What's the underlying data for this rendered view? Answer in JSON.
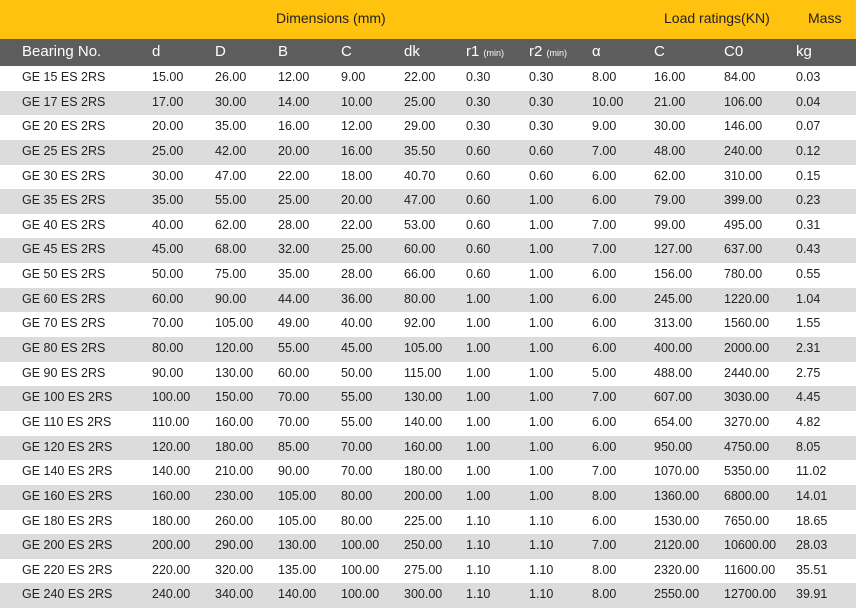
{
  "header": {
    "dimensions_label": "Dimensions (mm)",
    "load_label": "Load ratings(KN)",
    "mass_label": "Mass"
  },
  "columns": [
    "Bearing No.",
    "d",
    "D",
    "B",
    "C",
    "dk",
    "r1",
    "r2",
    "α",
    "C",
    "C0",
    "kg"
  ],
  "column_notes": {
    "r1": "(min)",
    "r2": "(min)"
  },
  "rows": [
    [
      "GE 15 ES  2RS",
      "15.00",
      "26.00",
      "12.00",
      "9.00",
      "22.00",
      "0.30",
      "0.30",
      "8.00",
      "16.00",
      "84.00",
      "0.03"
    ],
    [
      "GE 17 ES  2RS",
      "17.00",
      "30.00",
      "14.00",
      "10.00",
      "25.00",
      "0.30",
      "0.30",
      "10.00",
      "21.00",
      "106.00",
      "0.04"
    ],
    [
      "GE 20 ES  2RS",
      "20.00",
      "35.00",
      "16.00",
      "12.00",
      "29.00",
      "0.30",
      "0.30",
      "9.00",
      "30.00",
      "146.00",
      "0.07"
    ],
    [
      "GE 25 ES  2RS",
      "25.00",
      "42.00",
      "20.00",
      "16.00",
      "35.50",
      "0.60",
      "0.60",
      "7.00",
      "48.00",
      "240.00",
      "0.12"
    ],
    [
      "GE 30 ES  2RS",
      "30.00",
      "47.00",
      "22.00",
      "18.00",
      "40.70",
      "0.60",
      "0.60",
      "6.00",
      "62.00",
      "310.00",
      "0.15"
    ],
    [
      "GE 35 ES  2RS",
      "35.00",
      "55.00",
      "25.00",
      "20.00",
      "47.00",
      "0.60",
      "1.00",
      "6.00",
      "79.00",
      "399.00",
      "0.23"
    ],
    [
      "GE 40 ES  2RS",
      "40.00",
      "62.00",
      "28.00",
      "22.00",
      "53.00",
      "0.60",
      "1.00",
      "7.00",
      "99.00",
      "495.00",
      "0.31"
    ],
    [
      "GE 45 ES  2RS",
      "45.00",
      "68.00",
      "32.00",
      "25.00",
      "60.00",
      "0.60",
      "1.00",
      "7.00",
      "127.00",
      "637.00",
      "0.43"
    ],
    [
      "GE 50 ES  2RS",
      "50.00",
      "75.00",
      "35.00",
      "28.00",
      "66.00",
      "0.60",
      "1.00",
      "6.00",
      "156.00",
      "780.00",
      "0.55"
    ],
    [
      "GE 60 ES  2RS",
      "60.00",
      "90.00",
      "44.00",
      "36.00",
      "80.00",
      "1.00",
      "1.00",
      "6.00",
      "245.00",
      "1220.00",
      "1.04"
    ],
    [
      "GE 70 ES  2RS",
      "70.00",
      "105.00",
      "49.00",
      "40.00",
      "92.00",
      "1.00",
      "1.00",
      "6.00",
      "313.00",
      "1560.00",
      "1.55"
    ],
    [
      "GE 80 ES  2RS",
      "80.00",
      "120.00",
      "55.00",
      "45.00",
      "105.00",
      "1.00",
      "1.00",
      "6.00",
      "400.00",
      "2000.00",
      "2.31"
    ],
    [
      "GE 90 ES  2RS",
      "90.00",
      "130.00",
      "60.00",
      "50.00",
      "115.00",
      "1.00",
      "1.00",
      "5.00",
      "488.00",
      "2440.00",
      "2.75"
    ],
    [
      "GE 100 ES  2RS",
      "100.00",
      "150.00",
      "70.00",
      "55.00",
      "130.00",
      "1.00",
      "1.00",
      "7.00",
      "607.00",
      "3030.00",
      "4.45"
    ],
    [
      "GE 110 ES  2RS",
      "110.00",
      "160.00",
      "70.00",
      "55.00",
      "140.00",
      "1.00",
      "1.00",
      "6.00",
      "654.00",
      "3270.00",
      "4.82"
    ],
    [
      "GE 120 ES  2RS",
      "120.00",
      "180.00",
      "85.00",
      "70.00",
      "160.00",
      "1.00",
      "1.00",
      "6.00",
      "950.00",
      "4750.00",
      "8.05"
    ],
    [
      "GE 140 ES  2RS",
      "140.00",
      "210.00",
      "90.00",
      "70.00",
      "180.00",
      "1.00",
      "1.00",
      "7.00",
      "1070.00",
      "5350.00",
      "11.02"
    ],
    [
      "GE 160 ES  2RS",
      "160.00",
      "230.00",
      "105.00",
      "80.00",
      "200.00",
      "1.00",
      "1.00",
      "8.00",
      "1360.00",
      "6800.00",
      "14.01"
    ],
    [
      "GE 180 ES  2RS",
      "180.00",
      "260.00",
      "105.00",
      "80.00",
      "225.00",
      "1.10",
      "1.10",
      "6.00",
      "1530.00",
      "7650.00",
      "18.65"
    ],
    [
      "GE 200 ES  2RS",
      "200.00",
      "290.00",
      "130.00",
      "100.00",
      "250.00",
      "1.10",
      "1.10",
      "7.00",
      "2120.00",
      "10600.00",
      "28.03"
    ],
    [
      "GE 220 ES  2RS",
      "220.00",
      "320.00",
      "135.00",
      "100.00",
      "275.00",
      "1.10",
      "1.10",
      "8.00",
      "2320.00",
      "11600.00",
      "35.51"
    ],
    [
      "GE 240 ES  2RS",
      "240.00",
      "340.00",
      "140.00",
      "100.00",
      "300.00",
      "1.10",
      "1.10",
      "8.00",
      "2550.00",
      "12700.00",
      "39.91"
    ]
  ],
  "colors": {
    "header_band": "#FFC20E",
    "column_header": "#5d5d5d",
    "stripe": "#dcdcdc"
  }
}
